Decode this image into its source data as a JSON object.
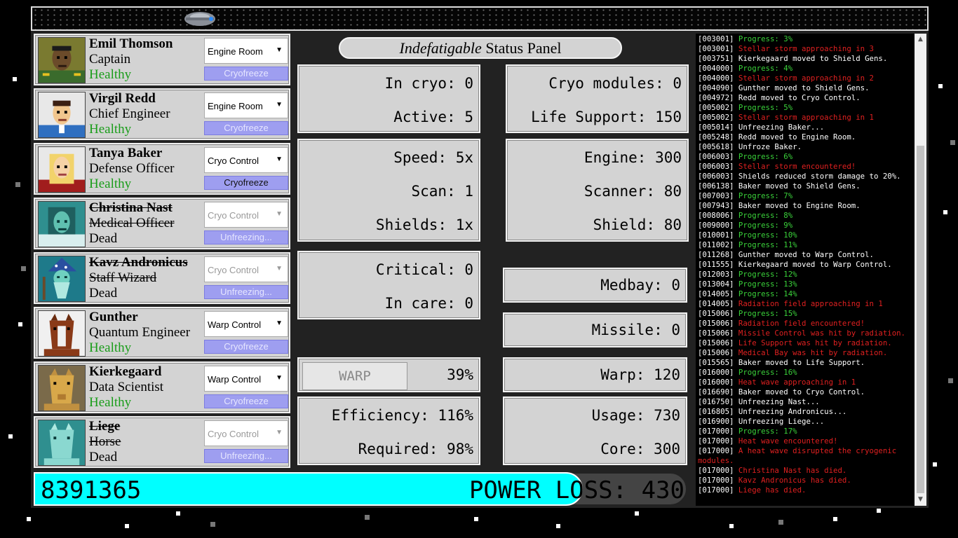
{
  "top_bar": {
    "ship": "spaceship-icon"
  },
  "crew": [
    {
      "name": "Emil Thomson",
      "role": "Captain",
      "status": "Healthy",
      "location": "Engine Room",
      "action": "Cryofreeze",
      "dead": false
    },
    {
      "name": "Virgil Redd",
      "role": "Chief Engineer",
      "status": "Healthy",
      "location": "Engine Room",
      "action": "Cryofreeze",
      "dead": false
    },
    {
      "name": "Tanya Baker",
      "role": "Defense Officer",
      "status": "Healthy",
      "location": "Cryo Control",
      "action": "Cryofreeze",
      "dead": false
    },
    {
      "name": "Christina Nast",
      "role": "Medical Officer",
      "status": "Dead",
      "location": "Cryo Control",
      "action": "Unfreezing...",
      "dead": true
    },
    {
      "name": "Kavz Andronicus",
      "role": "Staff Wizard",
      "status": "Dead",
      "location": "Cryo Control",
      "action": "Unfreezing...",
      "dead": true
    },
    {
      "name": "Gunther",
      "role": "Quantum Engineer",
      "status": "Healthy",
      "location": "Warp Control",
      "action": "Cryofreeze",
      "dead": false
    },
    {
      "name": "Kierkegaard",
      "role": "Data Scientist",
      "status": "Healthy",
      "location": "Warp Control",
      "action": "Cryofreeze",
      "dead": false
    },
    {
      "name": "Liege",
      "role": "Horse",
      "status": "Dead",
      "location": "Cryo Control",
      "action": "Unfreezing...",
      "dead": true
    }
  ],
  "panel": {
    "title_italic": "Indefatigable",
    "title_rest": " Status Panel",
    "in_cryo": "In cryo: 0",
    "active": "Active: 5",
    "cryo_modules": "Cryo modules: 0",
    "life_support": "Life Support: 150",
    "speed": "Speed: 5x",
    "scan": "Scan: 1",
    "shields": "Shields: 1x",
    "engine": "Engine: 300",
    "scanner": "Scanner: 80",
    "shield": "Shield: 80",
    "critical": "Critical: 0",
    "in_care": "In care: 0",
    "medbay": "Medbay: 0",
    "missile": "Missile: 0",
    "warp_button": "WARP",
    "warp_percent": "39%",
    "warp": "Warp: 120",
    "efficiency": "Efficiency: 116%",
    "required": "Required: 98%",
    "usage": "Usage: 730",
    "core": "Core: 300"
  },
  "bottom": {
    "score": "8391365",
    "power_loss": "POWER LOSS: 430",
    "power_fill": 0.84
  },
  "log": [
    {
      "t": "[003001] ",
      "m": "Progress: 3%",
      "c": "p"
    },
    {
      "t": "[003001] ",
      "m": "Stellar storm approaching in 3",
      "c": "r"
    },
    {
      "t": "[003751] ",
      "m": "Kierkegaard moved to Shield Gens.",
      "c": "w"
    },
    {
      "t": "[004000] ",
      "m": "Progress: 4%",
      "c": "p"
    },
    {
      "t": "[004000] ",
      "m": "Stellar storm approaching in 2",
      "c": "r"
    },
    {
      "t": "[004090] ",
      "m": "Gunther moved to Shield Gens.",
      "c": "w"
    },
    {
      "t": "[004972] ",
      "m": "Redd moved to Cryo Control.",
      "c": "w"
    },
    {
      "t": "[005002] ",
      "m": "Progress: 5%",
      "c": "p"
    },
    {
      "t": "[005002] ",
      "m": "Stellar storm approaching in 1",
      "c": "r"
    },
    {
      "t": "[005014] ",
      "m": "Unfreezing Baker...",
      "c": "w"
    },
    {
      "t": "[005248] ",
      "m": "Redd moved to Engine Room.",
      "c": "w"
    },
    {
      "t": "[005618] ",
      "m": "Unfroze Baker.",
      "c": "w"
    },
    {
      "t": "[006003] ",
      "m": "Progress: 6%",
      "c": "p"
    },
    {
      "t": "[006003] ",
      "m": "Stellar storm encountered!",
      "c": "r"
    },
    {
      "t": "[006003] ",
      "m": "Shields reduced storm damage to 20%.",
      "c": "w"
    },
    {
      "t": "[006138] ",
      "m": "Baker moved to Shield Gens.",
      "c": "w"
    },
    {
      "t": "[007003] ",
      "m": "Progress: 7%",
      "c": "p"
    },
    {
      "t": "[007943] ",
      "m": "Baker moved to Engine Room.",
      "c": "w"
    },
    {
      "t": "[008006] ",
      "m": "Progress: 8%",
      "c": "p"
    },
    {
      "t": "[009000] ",
      "m": "Progress: 9%",
      "c": "p"
    },
    {
      "t": "[010001] ",
      "m": "Progress: 10%",
      "c": "p"
    },
    {
      "t": "[011002] ",
      "m": "Progress: 11%",
      "c": "p"
    },
    {
      "t": "[011268] ",
      "m": "Gunther moved to Warp Control.",
      "c": "w"
    },
    {
      "t": "[011555] ",
      "m": "Kierkegaard moved to Warp Control.",
      "c": "w"
    },
    {
      "t": "[012003] ",
      "m": "Progress: 12%",
      "c": "p"
    },
    {
      "t": "[013004] ",
      "m": "Progress: 13%",
      "c": "p"
    },
    {
      "t": "[014005] ",
      "m": "Progress: 14%",
      "c": "p"
    },
    {
      "t": "[014005] ",
      "m": "Radiation field approaching in 1",
      "c": "r"
    },
    {
      "t": "[015006] ",
      "m": "Progress: 15%",
      "c": "p"
    },
    {
      "t": "[015006] ",
      "m": "Radiation field encountered!",
      "c": "r"
    },
    {
      "t": "[015006] ",
      "m": "Missile Control was hit by radiation.",
      "c": "r"
    },
    {
      "t": "[015006] ",
      "m": "Life Support was hit by radiation.",
      "c": "r"
    },
    {
      "t": "[015006] ",
      "m": "Medical Bay was hit by radiation.",
      "c": "r"
    },
    {
      "t": "[015565] ",
      "m": "Baker moved to Life Support.",
      "c": "w"
    },
    {
      "t": "[016000] ",
      "m": "Progress: 16%",
      "c": "p"
    },
    {
      "t": "[016000] ",
      "m": "Heat wave approaching in 1",
      "c": "r"
    },
    {
      "t": "[016690] ",
      "m": "Baker moved to Cryo Control.",
      "c": "w"
    },
    {
      "t": "[016750] ",
      "m": "Unfreezing Nast...",
      "c": "w"
    },
    {
      "t": "[016805] ",
      "m": "Unfreezing Andronicus...",
      "c": "w"
    },
    {
      "t": "[016900] ",
      "m": "Unfreezing Liege...",
      "c": "w"
    },
    {
      "t": "[017000] ",
      "m": "Progress: 17%",
      "c": "p"
    },
    {
      "t": "[017000] ",
      "m": "Heat wave encountered!",
      "c": "r"
    },
    {
      "t": "[017000] ",
      "m": "A heat wave disrupted the cryogenic modules.",
      "c": "r"
    },
    {
      "t": "[017000] ",
      "m": "Christina Nast has died.",
      "c": "r"
    },
    {
      "t": "[017000] ",
      "m": "Kavz Andronicus has died.",
      "c": "r"
    },
    {
      "t": "[017000] ",
      "m": "Liege has died.",
      "c": "r"
    }
  ]
}
